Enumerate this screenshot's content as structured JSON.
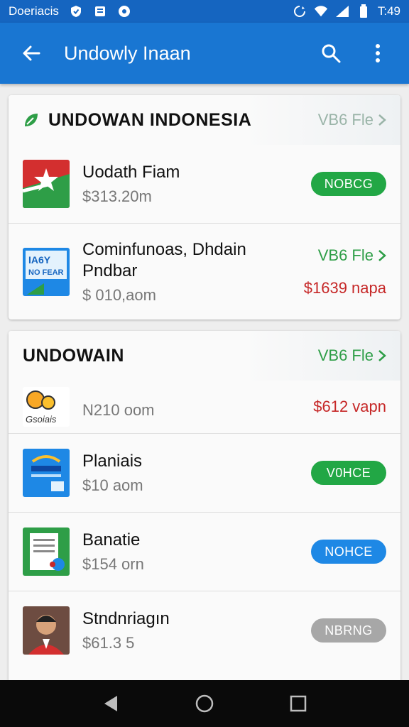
{
  "status_bar": {
    "carrier": "Doeriacis",
    "time": "T:49"
  },
  "app_bar": {
    "title": "Undowly Inaan"
  },
  "section1": {
    "title": "UNDOWAN INDONESIA",
    "view_link": "VB6 Fle",
    "items": [
      {
        "name": "Uodath Fiam",
        "price": "$313.20m",
        "button": "NOBCG",
        "button_color": "#22a745"
      },
      {
        "name": "Cominfunoas, Dhdain Pndbar",
        "price": "$ 010,aom",
        "link": "VB6 Fle",
        "right_price": "$1639 napa"
      }
    ]
  },
  "section2": {
    "title": "UNDOWAIN",
    "view_link": "VB6 Fle",
    "items": [
      {
        "name": "",
        "price": "N210 oom",
        "right_price": "$612 vapn"
      },
      {
        "name": "Planiais",
        "price": "$10 aom",
        "button": "V0HCE",
        "button_color": "#22a745"
      },
      {
        "name": "Banatie",
        "price": "$154 orn",
        "button": "NOHCE",
        "button_color": "#1e88e5"
      },
      {
        "name": "Stndnriagın",
        "price": "$61.3 5",
        "button": "NBRNG",
        "button_color": "#a7a7a7"
      }
    ]
  },
  "colors": {
    "primary": "#1976d2",
    "status_bar": "#1565c0",
    "green": "#22a745",
    "blue": "#1e88e5",
    "red": "#c62828"
  }
}
